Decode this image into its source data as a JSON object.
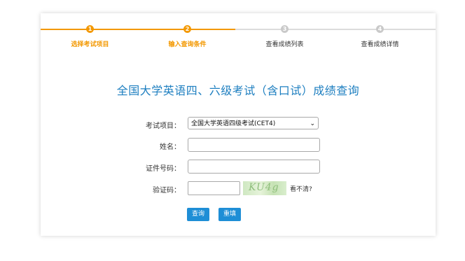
{
  "steps": [
    {
      "number": "1",
      "label": "选择考试项目",
      "state": "active"
    },
    {
      "number": "2",
      "label": "输入查询条件",
      "state": "active"
    },
    {
      "number": "3",
      "label": "查看成绩列表",
      "state": "inactive"
    },
    {
      "number": "4",
      "label": "查看成绩详情",
      "state": "inactive"
    }
  ],
  "title": "全国大学英语四、六级考试（含口试）成绩查询",
  "form": {
    "exam_label": "考试项目：",
    "exam_selected": "全国大学英语四级考试(CET4)",
    "name_label": "姓名：",
    "name_value": "",
    "id_label": "证件号码：",
    "id_value": "",
    "captcha_label": "验证码：",
    "captcha_value": "",
    "captcha_text": "KU4g",
    "captcha_refresh": "看不清?"
  },
  "buttons": {
    "query": "查询",
    "reset": "重填"
  },
  "colors": {
    "accent": "#f39800",
    "inactive": "#c9c9c9",
    "title": "#1e7fc0",
    "button": "#1e8ed6"
  }
}
